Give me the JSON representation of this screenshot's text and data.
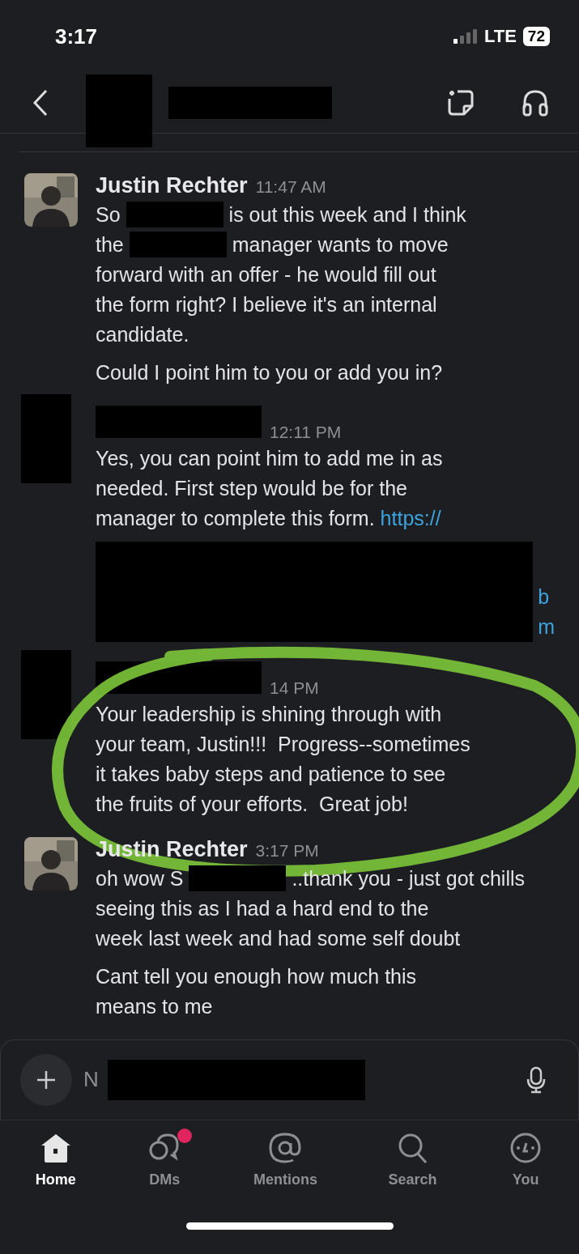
{
  "status_bar": {
    "time": "3:17",
    "network": "LTE",
    "battery": "72"
  },
  "messages": [
    {
      "sender": "Justin Rechter",
      "time": "11:47 AM",
      "highlighted": false,
      "paragraphs": [
        [
          [
            {
              "kind": "text",
              "text": "So"
            },
            {
              "kind": "redaction"
            },
            {
              "kind": "text",
              "text": "is out this week and I think"
            }
          ],
          [
            {
              "kind": "text",
              "text": "the"
            },
            {
              "kind": "redaction"
            },
            {
              "kind": "text",
              "text": "manager wants to move"
            }
          ],
          [
            {
              "kind": "text",
              "text": "forward with an offer - he would fill out"
            }
          ],
          [
            {
              "kind": "text",
              "text": "the form right? I believe it's an internal"
            }
          ],
          [
            {
              "kind": "text",
              "text": "candidate."
            }
          ]
        ],
        [
          [
            {
              "kind": "text",
              "text": "Could I point him to you or add you in?"
            }
          ]
        ]
      ]
    },
    {
      "time": "12:11 PM",
      "highlighted": false,
      "paragraphs": [
        [
          [
            {
              "kind": "text",
              "text": "Yes, you can point him to add me in as"
            }
          ],
          [
            {
              "kind": "text",
              "text": "needed. First step would be for the"
            }
          ],
          [
            {
              "kind": "text",
              "text": "manager to complete this form."
            },
            {
              "kind": "link",
              "text": "https://"
            }
          ]
        ]
      ],
      "redacted_block": {
        "link_fragments": [
          "b",
          "m"
        ]
      }
    },
    {
      "time": "14 PM",
      "highlighted": true,
      "paragraphs": [
        [
          [
            {
              "kind": "text",
              "text": "Your leadership is shining through with"
            }
          ],
          [
            {
              "kind": "text",
              "text": "your team, Justin!!!  Progress--sometimes"
            }
          ],
          [
            {
              "kind": "text",
              "text": "it takes baby steps and patience to see"
            }
          ],
          [
            {
              "kind": "text",
              "text": "the fruits of your efforts.  Great job!"
            }
          ]
        ]
      ]
    },
    {
      "sender": "Justin Rechter",
      "time": "3:17 PM",
      "highlighted": false,
      "paragraphs": [
        [
          [
            {
              "kind": "text",
              "text": "oh wow S"
            },
            {
              "kind": "redaction"
            },
            {
              "kind": "text",
              "text": "..thank you - just got chills"
            }
          ],
          [
            {
              "kind": "text",
              "text": "seeing this as I had a hard end to the"
            }
          ],
          [
            {
              "kind": "text",
              "text": "week last week and had some self doubt"
            }
          ]
        ],
        [
          [
            {
              "kind": "text",
              "text": "Cant tell you enough how much this"
            }
          ],
          [
            {
              "kind": "text",
              "text": "means to me"
            }
          ]
        ]
      ]
    }
  ],
  "composer": {
    "placeholder": "N"
  },
  "tabs": [
    {
      "label": "Home",
      "selected": true,
      "badge": false
    },
    {
      "label": "DMs",
      "selected": false,
      "badge": true
    },
    {
      "label": "Mentions",
      "selected": false,
      "badge": false
    },
    {
      "label": "Search",
      "selected": false,
      "badge": false
    },
    {
      "label": "You",
      "selected": false,
      "badge": false
    }
  ]
}
